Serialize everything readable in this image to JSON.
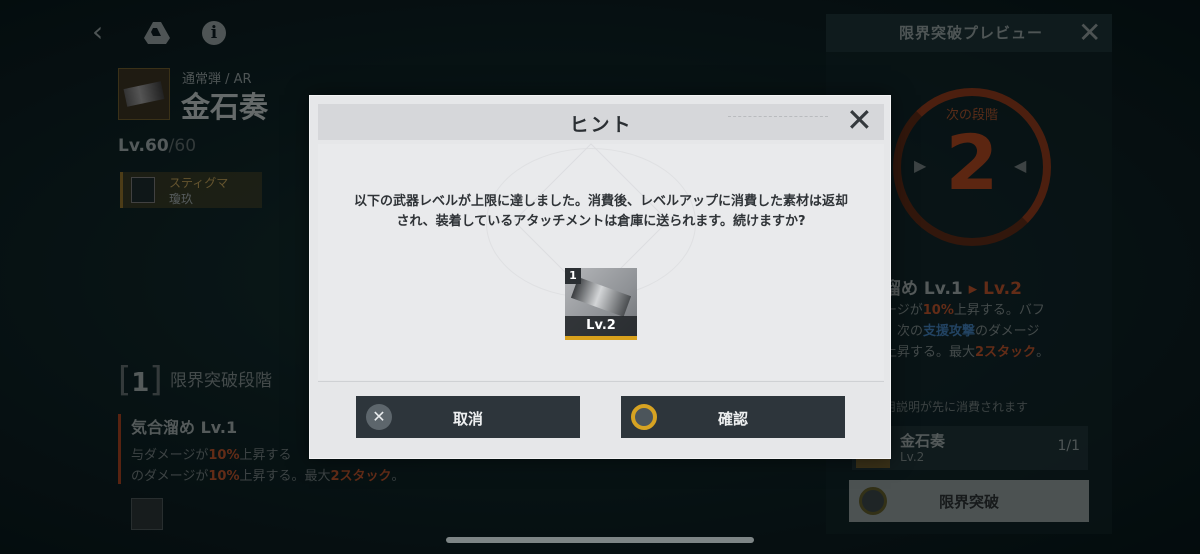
{
  "background": {
    "ammo_type": "通常弾 / AR",
    "weapon_name": "金石奏",
    "level": "Lv.60",
    "level_max": "/60",
    "stigma_label": "スティグマ",
    "stigma_name": "瓊玖",
    "stage_number": "1",
    "stage_title": "限界突破段階",
    "skill_name": "気合溜め Lv.1",
    "skill_desc_line1": [
      "与ダメージが",
      "10%",
      "上昇する"
    ],
    "skill_desc_line2": [
      "のダメージが",
      "10%",
      "上昇する。最大",
      "2スタック",
      "。"
    ]
  },
  "preview_panel": {
    "title": "限界突破プレビュー",
    "next_stage_label": "次の段階",
    "next_stage_number": "2",
    "skill_from": "溜め Lv.1",
    "skill_arrow": "▸",
    "skill_to": "Lv.2",
    "desc_parts": [
      "ージが",
      "10%",
      "上昇する。バフ",
      "、次の",
      "支援攻撃",
      "のダメージ",
      "上昇する。最大",
      "2スタック",
      "。"
    ],
    "material_note": "用説明が先に消費されます",
    "material_name": "金石奏",
    "material_level": "Lv.2",
    "material_count": "1/1",
    "limit_break_button": "限界突破"
  },
  "dialog": {
    "title": "ヒント",
    "message_line1": "以下の武器レベルが上限に達しました。消費後、レベルアップに消費した素材は返却",
    "message_line2": "され、装着しているアタッチメントは倉庫に送られます。続けますか?",
    "item_badge": "1",
    "item_level": "Lv.2",
    "cancel_label": "取消",
    "confirm_label": "確認"
  },
  "colors": {
    "accent_orange": "#b4512b",
    "accent_blue": "#3e7ab3",
    "confirm_ring": "#d7a322"
  }
}
